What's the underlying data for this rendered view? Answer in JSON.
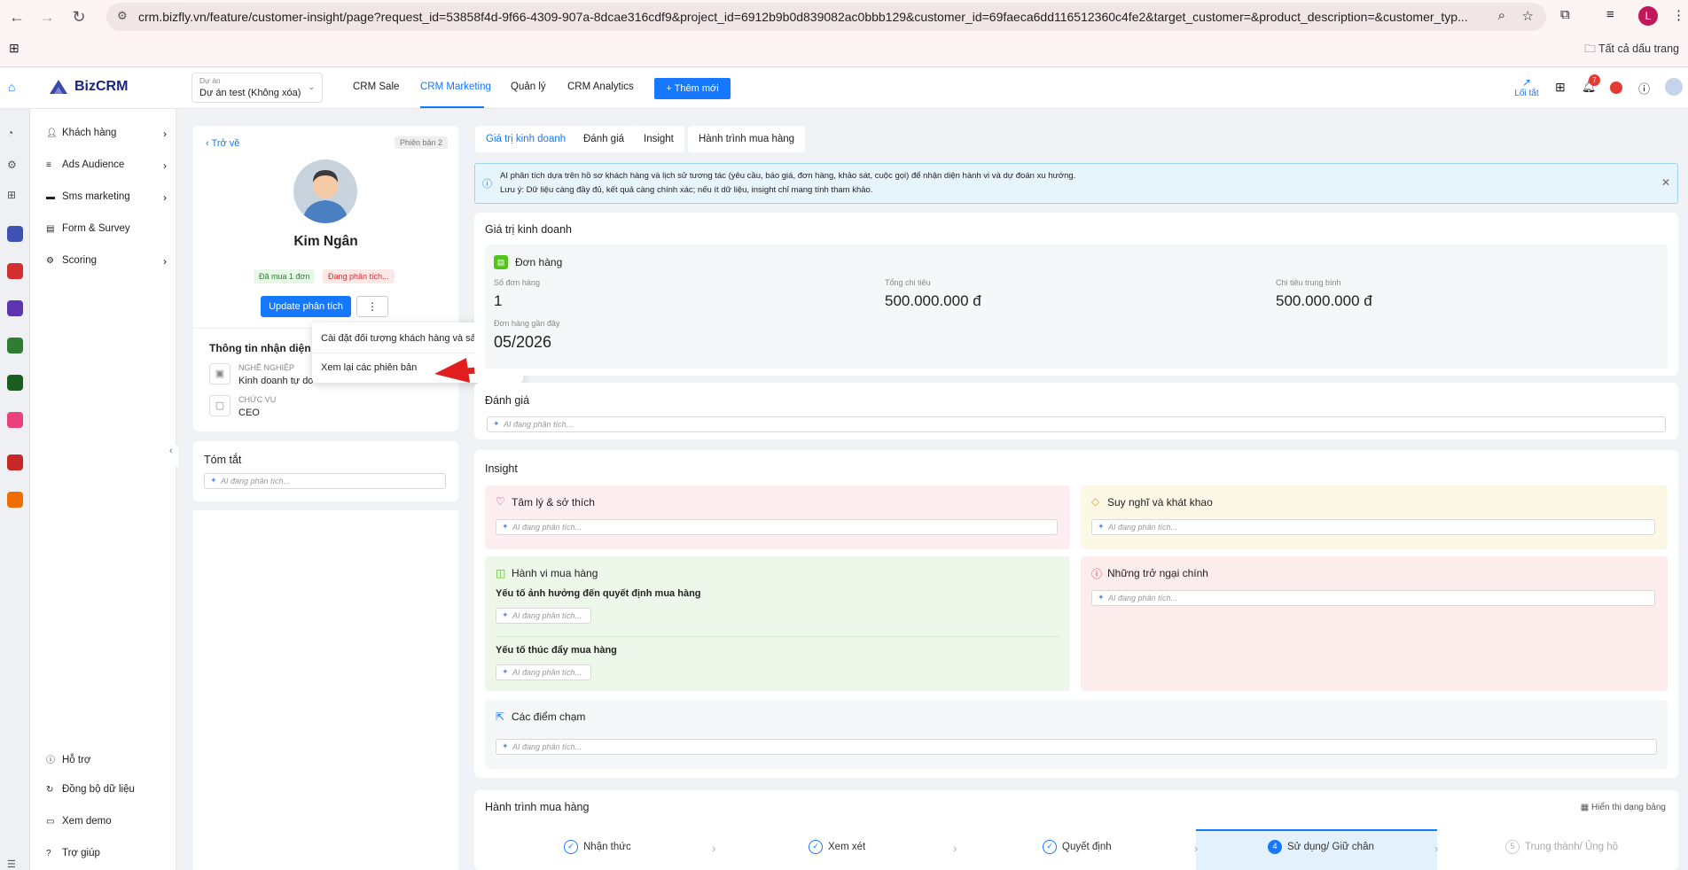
{
  "browser": {
    "url": "crm.bizfly.vn/feature/customer-insight/page?request_id=53858f4d-9f66-4309-907a-8dcae316cdf9&project_id=6912b9b0d839082ac0bbb129&customer_id=69faeca6dd116512360c4fe2&target_customer=&product_description=&customer_typ...",
    "bookmarks": "Tất cả dấu trang",
    "profile": "L"
  },
  "topnav": {
    "logo": "BizCRM",
    "logo_biz": "Biz",
    "logo_crm": "CRM",
    "project_label": "Dự án",
    "project_value": "Dự án test (Không xóa)",
    "menu": [
      "CRM Sale",
      "CRM Marketing",
      "Quản lý",
      "CRM Analytics"
    ],
    "active": "CRM Marketing",
    "add_button": "+ Thêm mới",
    "shortcut": "Lối tắt",
    "notif_count": "7"
  },
  "sidebar": {
    "items": [
      "Khách hàng",
      "Ads Audience",
      "Sms marketing",
      "Form & Survey",
      "Scoring"
    ],
    "bottom": [
      "Hỗ trợ",
      "Đồng bộ dữ liệu",
      "Xem demo",
      "Trợ giúp"
    ]
  },
  "profile": {
    "back": "Trở về",
    "version": "Phiên bản 2",
    "name": "Kim Ngân",
    "tag1": "Đã mua 1 đơn",
    "tag2": "Đang phân tích...",
    "update_btn": "Update phân tích",
    "more": "⋮",
    "identity_title": "Thông tin nhận diện",
    "job_label": "NGHỀ NGHIỆP",
    "job_value": "Kinh doanh tự do",
    "role_label": "CHỨC VỤ",
    "role_value": "CEO",
    "summary_title": "Tóm tắt",
    "summary_placeholder": "AI đang phân tích..."
  },
  "dropdown": {
    "item1": "Cài đặt đối tượng khách hàng và sản phẩm",
    "item2": "Xem lại các phiên bản"
  },
  "tabs": [
    "Giá trị kinh doanh",
    "Đánh giá",
    "Insight",
    "Hành trình mua hàng"
  ],
  "notice": {
    "line1": "AI phân tích dựa trên hồ sơ khách hàng và lịch sử tương tác (yêu cầu, báo giá, đơn hàng, khảo sát, cuộc gọi) để nhận diện hành vi và dự đoán xu hướng.",
    "line2": "Lưu ý: Dữ liệu càng đầy đủ, kết quả càng chính xác; nếu ít dữ liệu, insight chỉ mang tính tham khảo."
  },
  "business": {
    "title": "Giá trị kinh doanh",
    "orders_title": "Đơn hàng",
    "order_count_label": "Số đơn hàng",
    "order_count": "1",
    "total_label": "Tổng chi tiêu",
    "total": "500.000.000 đ",
    "avg_label": "Chi tiêu trung bình",
    "avg": "500.000.000 đ",
    "recent_label": "Đơn hàng gần đây",
    "recent": "05/2026"
  },
  "evaluate": {
    "title": "Đánh giá",
    "placeholder": "AI đang phân tích..."
  },
  "insight": {
    "title": "Insight",
    "psych": "Tâm lý & sở thích",
    "thought": "Suy nghĩ và khát khao",
    "behavior": "Hành vi mua hàng",
    "factor1": "Yếu tố ảnh hưởng đến quyết định mua hàng",
    "factor2": "Yếu tố thúc đẩy mua hàng",
    "obstacles": "Những trở ngại chính",
    "touch": "Các điểm chạm",
    "placeholder": "AI đang phân tích..."
  },
  "journey": {
    "title": "Hành trình mua hàng",
    "table_view": "Hiển thị dạng bảng",
    "steps": [
      "Nhận thức",
      "Xem xét",
      "Quyết định",
      "Sử dụng/ Giữ chân",
      "Trung thành/ Ủng hộ"
    ],
    "step4_num": "4",
    "step5_num": "5"
  },
  "colors": {
    "primary": "#1677ff",
    "accent": "#e53935"
  }
}
